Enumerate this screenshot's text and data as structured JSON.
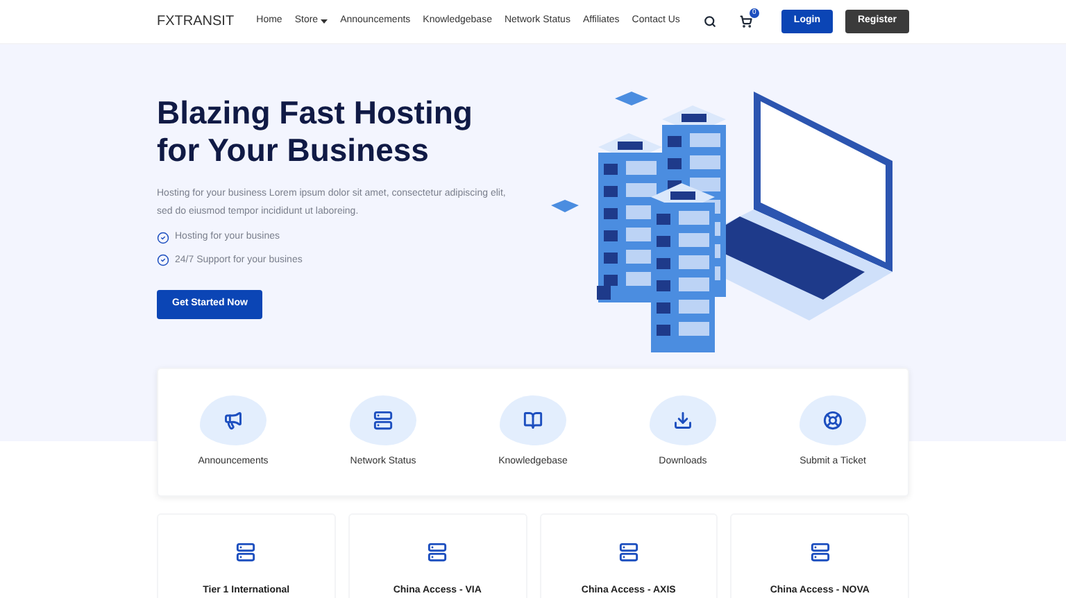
{
  "header": {
    "brand": "FXTRANSIT",
    "nav": [
      {
        "label": "Home",
        "dropdown": false
      },
      {
        "label": "Store",
        "dropdown": true
      },
      {
        "label": "Announcements",
        "dropdown": false
      },
      {
        "label": "Knowledgebase",
        "dropdown": false
      },
      {
        "label": "Network Status",
        "dropdown": false
      },
      {
        "label": "Affiliates",
        "dropdown": false
      },
      {
        "label": "Contact Us",
        "dropdown": false
      }
    ],
    "cart_count": "0",
    "login": "Login",
    "register": "Register"
  },
  "hero": {
    "title_lines": [
      "Blazing Fast Hosting",
      "for Your Business"
    ],
    "description": "Hosting for your business Lorem ipsum dolor sit amet, consectetur adipiscing elit, sed do eiusmod tempor incididunt ut laboreing.",
    "features": [
      "Hosting for your busines",
      "24/7 Support for your busines"
    ],
    "cta": "Get Started Now"
  },
  "quick_links": [
    {
      "kind": "megaphone",
      "label": "Announcements"
    },
    {
      "kind": "server",
      "label": "Network Status"
    },
    {
      "kind": "book",
      "label": "Knowledgebase"
    },
    {
      "kind": "download",
      "label": "Downloads"
    },
    {
      "kind": "lifebuoy",
      "label": "Submit a Ticket"
    }
  ],
  "plans": [
    {
      "title": "Tier 1 International"
    },
    {
      "title": "China Access - VIA"
    },
    {
      "title": "China Access - AXIS"
    },
    {
      "title": "China Access - NOVA"
    }
  ]
}
